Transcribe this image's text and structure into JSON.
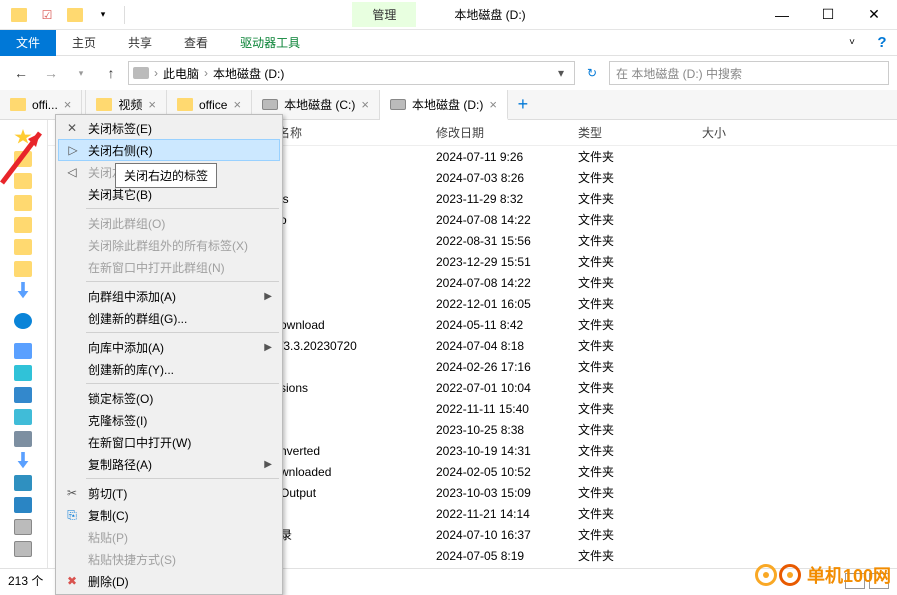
{
  "window": {
    "title": "本地磁盘 (D:)",
    "manage_tab": "管理"
  },
  "ribbon": {
    "file": "文件",
    "home": "主页",
    "share": "共享",
    "view": "查看",
    "drive_tools": "驱动器工具"
  },
  "address": {
    "pc": "此电脑",
    "drive": "本地磁盘 (D:)"
  },
  "search": {
    "placeholder": "在 本地磁盘 (D:) 中搜索"
  },
  "tabs": [
    {
      "label": "offi...",
      "kind": "folder"
    },
    {
      "label": "视频",
      "kind": "folder"
    },
    {
      "label": "office",
      "kind": "folder"
    },
    {
      "label": "本地磁盘 (C:)",
      "kind": "drive"
    },
    {
      "label": "本地磁盘 (D:)",
      "kind": "drive",
      "active": true
    }
  ],
  "columns": {
    "name": "名称",
    "date": "修改日期",
    "type": "类型",
    "size": "大小"
  },
  "files": [
    {
      "name": "",
      "date": "2024-07-11 9:26",
      "type": "文件夹"
    },
    {
      "name": "",
      "date": "2024-07-03 8:26",
      "type": "文件夹"
    },
    {
      "name": "ls",
      "date": "2023-11-29 8:32",
      "type": "文件夹"
    },
    {
      "name": "o",
      "date": "2024-07-08 14:22",
      "type": "文件夹"
    },
    {
      "name": "",
      "date": "2022-08-31 15:56",
      "type": "文件夹"
    },
    {
      "name": "",
      "date": "2023-12-29 15:51",
      "type": "文件夹"
    },
    {
      "name": "",
      "date": "2024-07-08 14:22",
      "type": "文件夹"
    },
    {
      "name": "",
      "date": "2022-12-01 16:05",
      "type": "文件夹"
    },
    {
      "name": "ownload",
      "date": "2024-05-11 8:42",
      "type": "文件夹"
    },
    {
      "name": "/3.3.20230720",
      "date": "2024-07-04 8:18",
      "type": "文件夹"
    },
    {
      "name": "",
      "date": "2024-02-26 17:16",
      "type": "文件夹"
    },
    {
      "name": "sions",
      "date": "2022-07-01 10:04",
      "type": "文件夹"
    },
    {
      "name": "",
      "date": "2022-11-11 15:40",
      "type": "文件夹"
    },
    {
      "name": "",
      "date": "2023-10-25 8:38",
      "type": "文件夹"
    },
    {
      "name": "nverted",
      "date": "2023-10-19 14:31",
      "type": "文件夹"
    },
    {
      "name": "wnloaded",
      "date": "2024-02-05 10:52",
      "type": "文件夹"
    },
    {
      "name": "Output",
      "date": "2023-10-03 15:09",
      "type": "文件夹"
    },
    {
      "name": "",
      "date": "2022-11-21 14:14",
      "type": "文件夹"
    },
    {
      "name": "录",
      "date": "2024-07-10 16:37",
      "type": "文件夹"
    },
    {
      "name": "",
      "date": "2024-07-05 8:19",
      "type": "文件夹"
    }
  ],
  "context_menu": {
    "items": [
      {
        "label": "关闭标签(E)",
        "icon": "x"
      },
      {
        "label": "关闭右侧(R)",
        "icon": "rtab",
        "highlighted": true
      },
      {
        "label": "关闭左侧(L)",
        "icon": "ltab",
        "disabled": true
      },
      {
        "label": "关闭其它(B)"
      },
      {
        "sep": true
      },
      {
        "label": "关闭此群组(O)",
        "disabled": true
      },
      {
        "label": "关闭除此群组外的所有标签(X)",
        "disabled": true
      },
      {
        "label": "在新窗口中打开此群组(N)",
        "disabled": true
      },
      {
        "sep": true
      },
      {
        "label": "向群组中添加(A)",
        "submenu": true
      },
      {
        "label": "创建新的群组(G)..."
      },
      {
        "sep": true
      },
      {
        "label": "向库中添加(A)",
        "submenu": true
      },
      {
        "label": "创建新的库(Y)..."
      },
      {
        "sep": true
      },
      {
        "label": "锁定标签(O)"
      },
      {
        "label": "克隆标签(I)"
      },
      {
        "label": "在新窗口中打开(W)"
      },
      {
        "label": "复制路径(A)",
        "submenu": true
      },
      {
        "sep": true
      },
      {
        "label": "剪切(T)",
        "icon": "cut"
      },
      {
        "label": "复制(C)",
        "icon": "copy"
      },
      {
        "label": "粘贴(P)",
        "disabled": true
      },
      {
        "label": "粘贴快捷方式(S)",
        "disabled": true
      },
      {
        "label": "删除(D)",
        "icon": "del"
      }
    ]
  },
  "tooltip": "关闭右边的标签",
  "status": {
    "count": "213 个"
  },
  "watermark": "单机100网"
}
